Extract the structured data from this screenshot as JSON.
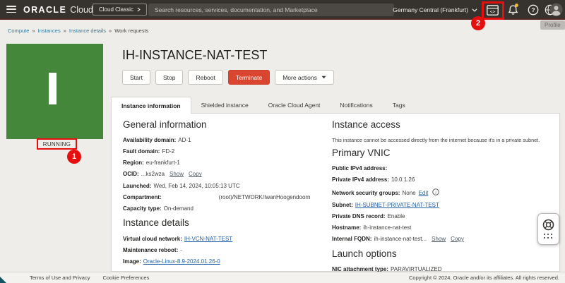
{
  "colors": {
    "topbar_bg": "#36322e",
    "annotation_red": "#e60f0f",
    "terminate_red": "#d9452f",
    "status_green": "#44863a",
    "link_blue": "#2162a8",
    "breadcrumb_teal": "#2c7c9e"
  },
  "icons": {
    "topbar": [
      "hamburger-icon",
      "chevron-right-icon",
      "chevron-down-icon",
      "developer-console-icon",
      "notifications-bell-icon",
      "help-icon",
      "language-globe-icon",
      "profile-avatar-icon"
    ],
    "content": [
      "info-icon",
      "caret-down-icon"
    ],
    "floating": [
      "support-life-ring-icon",
      "drag-dots-icon"
    ]
  },
  "topbar": {
    "brand_oracle": "ORACLE",
    "brand_cloud": "Cloud",
    "cloud_classic": "Cloud Classic",
    "search_placeholder": "Search resources, services, documentation, and Marketplace",
    "region": "Germany Central (Frankfurt)",
    "profile_tooltip": "Profile"
  },
  "annotations": {
    "step1": "1",
    "step2": "2"
  },
  "breadcrumb": {
    "separator": "»",
    "items": [
      "Compute",
      "Instances",
      "Instance details",
      "Work requests"
    ]
  },
  "instance": {
    "title": "IH-INSTANCE-NAT-TEST",
    "status": "RUNNING"
  },
  "actions": {
    "start": "Start",
    "stop": "Stop",
    "reboot": "Reboot",
    "terminate": "Terminate",
    "more": "More actions"
  },
  "tabs": [
    "Instance information",
    "Shielded instance",
    "Oracle Cloud Agent",
    "Notifications",
    "Tags"
  ],
  "general": {
    "heading": "General information",
    "fields": [
      {
        "label": "Availability domain:",
        "value": "AD-1"
      },
      {
        "label": "Fault domain:",
        "value": "FD-2"
      },
      {
        "label": "Region:",
        "value": "eu-frankfurt-1"
      },
      {
        "label": "OCID:",
        "value": "...ks2wza",
        "links": [
          "Show",
          "Copy"
        ]
      },
      {
        "label": "Launched:",
        "value": "Wed, Feb 14, 2024, 10:05:13 UTC"
      },
      {
        "label": "Compartment:",
        "value": "(root)/NETWORK/IwanHoogendoorn"
      },
      {
        "label": "Capacity type:",
        "value": "On-demand"
      }
    ]
  },
  "instance_details": {
    "heading": "Instance details",
    "fields": [
      {
        "label": "Virtual cloud network:",
        "link": "IH-VCN-NAT-TEST"
      },
      {
        "label": "Maintenance reboot:",
        "value": "-"
      },
      {
        "label": "Image:",
        "link": "Oracle-Linux-8.9-2024.01.26-0"
      }
    ]
  },
  "instance_access": {
    "heading": "Instance access",
    "note": "This instance cannot be accessed directly from the internet because it's in a private subnet."
  },
  "primary_vnic": {
    "heading": "Primary VNIC",
    "fields": [
      {
        "label": "Public IPv4 address:",
        "value": ""
      },
      {
        "label": "Private IPv4 address:",
        "value": "10.0.1.26"
      },
      {
        "label": "Network security groups:",
        "value": "None",
        "edit_link": "Edit"
      },
      {
        "label": "Subnet:",
        "link": "IH-SUBNET-PRIVATE-NAT-TEST"
      },
      {
        "label": "Private DNS record:",
        "value": "Enable"
      },
      {
        "label": "Hostname:",
        "value": "ih-instance-nat-test"
      },
      {
        "label": "Internal FQDN:",
        "value": "ih-instance-nat-test...",
        "links": [
          "Show",
          "Copy"
        ]
      }
    ]
  },
  "launch_options": {
    "heading": "Launch options",
    "fields": [
      {
        "label": "NIC attachment type:",
        "value": "PARAVIRTUALIZED"
      }
    ]
  },
  "footer": {
    "links": [
      "Terms of Use and Privacy",
      "Cookie Preferences"
    ],
    "copyright": "Copyright © 2024, Oracle and/or its affiliates. All rights reserved."
  }
}
